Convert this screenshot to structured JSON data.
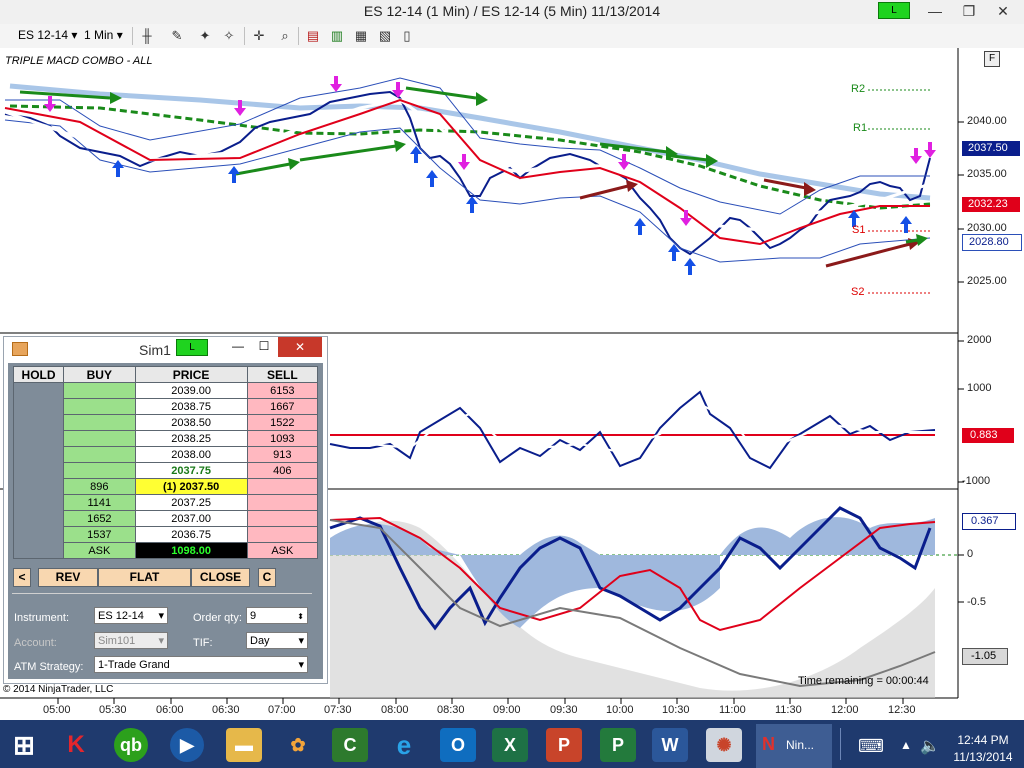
{
  "window": {
    "title": "ES 12-14 (1 Min) / ES 12-14 (5 Min)  11/13/2014",
    "status_light": "L",
    "min_label": "—",
    "restore_label": "❐",
    "close_label": "✕"
  },
  "toolbar": {
    "instrument": "ES 12-14",
    "interval": "1 Min"
  },
  "chart": {
    "indicator_label": "TRIPLE MACD COMBO - ALL",
    "f_button": "F",
    "copyright": "© 2014 NinjaTrader, LLC",
    "time_remaining": "Time remaining = 00:00:44",
    "pivot_labels": {
      "r2": "R2",
      "r1": "R1",
      "s1": "S1",
      "s2": "S2"
    },
    "price_ticks": [
      "2040.00",
      "2035.00",
      "2030.00",
      "2025.00"
    ],
    "price_tags": {
      "last": "2037.50",
      "red": "2032.23",
      "blue": "2028.80"
    },
    "pane2_ticks": [
      "2000",
      "1000",
      "-1000"
    ],
    "pane2_tag": "0.883",
    "pane3_ticks": [
      "0",
      "-0.5"
    ],
    "pane3_tags": {
      "upper": "0.367",
      "lower": "-1.05"
    },
    "time_ticks": [
      "05:00",
      "05:30",
      "06:00",
      "06:30",
      "07:00",
      "07:30",
      "08:00",
      "08:30",
      "09:00",
      "09:30",
      "10:00",
      "10:30",
      "11:00",
      "11:30",
      "12:00",
      "12:30"
    ]
  },
  "dom": {
    "title": "Sim1",
    "status_light": "L",
    "min_label": "—",
    "max_label": "☐",
    "close_label": "✕",
    "headers": {
      "hold": "HOLD",
      "buy": "BUY",
      "price": "PRICE",
      "sell": "SELL"
    },
    "rows": [
      {
        "buy": "",
        "price": "2039.00",
        "sell": "6153"
      },
      {
        "buy": "",
        "price": "2038.75",
        "sell": "1667"
      },
      {
        "buy": "",
        "price": "2038.50",
        "sell": "1522"
      },
      {
        "buy": "",
        "price": "2038.25",
        "sell": "1093"
      },
      {
        "buy": "",
        "price": "2038.00",
        "sell": "913"
      },
      {
        "buy": "",
        "price": "2037.75",
        "sell": "406"
      },
      {
        "buy": "896",
        "price": "(1) 2037.50",
        "sell": ""
      },
      {
        "buy": "1141",
        "price": "2037.25",
        "sell": ""
      },
      {
        "buy": "1652",
        "price": "2037.00",
        "sell": ""
      },
      {
        "buy": "1537",
        "price": "2036.75",
        "sell": ""
      }
    ],
    "footer": {
      "ask_left": "ASK",
      "pnl": "1098.00",
      "ask_right": "ASK"
    },
    "buttons": {
      "left": "<",
      "rev": "REV",
      "flat": "FLAT",
      "close": "CLOSE",
      "c": "C"
    },
    "form": {
      "instrument_label": "Instrument:",
      "instrument_value": "ES 12-14",
      "order_qty_label": "Order qty:",
      "order_qty_value": "9",
      "account_label": "Account:",
      "account_value": "Sim101",
      "tif_label": "TIF:",
      "tif_value": "Day",
      "atm_label": "ATM Strategy:",
      "atm_value": "1-Trade Grand"
    }
  },
  "taskbar": {
    "clock_time": "12:44 PM",
    "clock_date": "11/13/2014",
    "ninja_label": "Nin..."
  },
  "colors": {
    "price_bars": "#0a1e8c",
    "ema_red": "#e0001a",
    "ema_green": "#1a8a1a",
    "buy_arrow": "#1450e6",
    "sell_arrow": "#e020e0"
  }
}
